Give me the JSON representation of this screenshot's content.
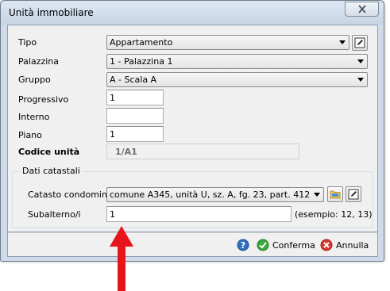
{
  "window": {
    "title": "Unità immobiliare"
  },
  "form": {
    "tipo": {
      "label": "Tipo",
      "value": "Appartamento"
    },
    "palazzina": {
      "label": "Palazzina",
      "value": "1 - Palazzina 1"
    },
    "gruppo": {
      "label": "Gruppo",
      "value": "A - Scala A"
    },
    "progressivo": {
      "label": "Progressivo",
      "value": "1"
    },
    "interno": {
      "label": "Interno",
      "value": ""
    },
    "piano": {
      "label": "Piano",
      "value": "1"
    },
    "codice": {
      "label": "Codice unità",
      "value": "1/A1"
    }
  },
  "catasto": {
    "group_title": "Dati catastali",
    "condominio": {
      "label": "Catasto condominio",
      "value": "comune A345, unità U, sz. A, fg. 23, part. 412"
    },
    "subalterno": {
      "label": "Subalterno/i",
      "value": "1",
      "hint": "(esempio: 12, 13)"
    }
  },
  "footer": {
    "confirm_label": "Conferma",
    "cancel_label": "Annulla"
  },
  "icons": {
    "help": "help-icon",
    "confirm": "check-icon",
    "cancel": "cancel-icon",
    "edit": "edit-icon",
    "folder": "folder-icon",
    "close": "close-icon"
  },
  "colors": {
    "annotation_arrow": "#e8141c",
    "confirm_green": "#3aa83a",
    "cancel_red": "#d9382b",
    "help_blue": "#2e6fc0"
  }
}
